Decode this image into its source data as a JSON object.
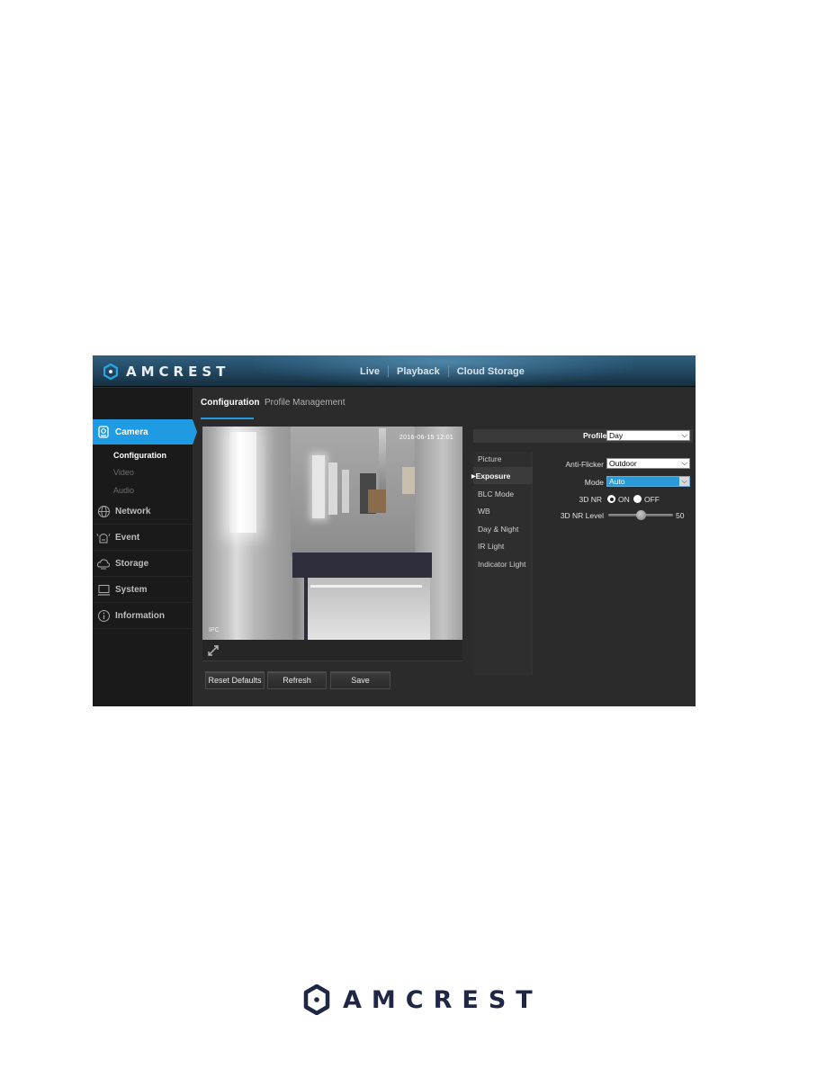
{
  "app": {
    "brand": "AMCREST",
    "brand_color": "#1e9be3"
  },
  "topnav": {
    "items": [
      {
        "label": "Live"
      },
      {
        "label": "Playback"
      },
      {
        "label": "Cloud Storage"
      }
    ]
  },
  "sidebar": {
    "items": [
      {
        "label": "Camera",
        "icon": "camera-icon",
        "active": true
      },
      {
        "label": "Network",
        "icon": "globe-icon"
      },
      {
        "label": "Event",
        "icon": "alarm-icon"
      },
      {
        "label": "Storage",
        "icon": "cloud-icon"
      },
      {
        "label": "System",
        "icon": "monitor-icon"
      },
      {
        "label": "Information",
        "icon": "info-icon"
      }
    ],
    "camera_subitems": [
      {
        "label": "Configuration",
        "active": true
      },
      {
        "label": "Video"
      },
      {
        "label": "Audio"
      }
    ]
  },
  "tabs": [
    {
      "label": "Configuration",
      "active": true
    },
    {
      "label": "Profile Management"
    }
  ],
  "video": {
    "timestamp": "2016-06-15 12:01",
    "channel_label": "IPC"
  },
  "buttons": {
    "reset_defaults": "Reset Defaults",
    "refresh": "Refresh",
    "save": "Save"
  },
  "settings": {
    "profile": {
      "label": "Profile",
      "value": "Day"
    },
    "submenu": [
      {
        "label": "Picture"
      },
      {
        "label": "Exposure",
        "active": true
      },
      {
        "label": "BLC Mode"
      },
      {
        "label": "WB"
      },
      {
        "label": "Day & Night"
      },
      {
        "label": "IR Light"
      },
      {
        "label": "Indicator Light"
      }
    ],
    "anti_flicker": {
      "label": "Anti-Flicker",
      "value": "Outdoor"
    },
    "mode": {
      "label": "Mode",
      "value": "Auto"
    },
    "nr3d": {
      "label": "3D NR",
      "on_label": "ON",
      "off_label": "OFF",
      "selected": "ON"
    },
    "nr3d_level": {
      "label": "3D NR Level",
      "value": 50,
      "min": 0,
      "max": 100
    }
  },
  "footer": {
    "brand": "AMCREST"
  }
}
